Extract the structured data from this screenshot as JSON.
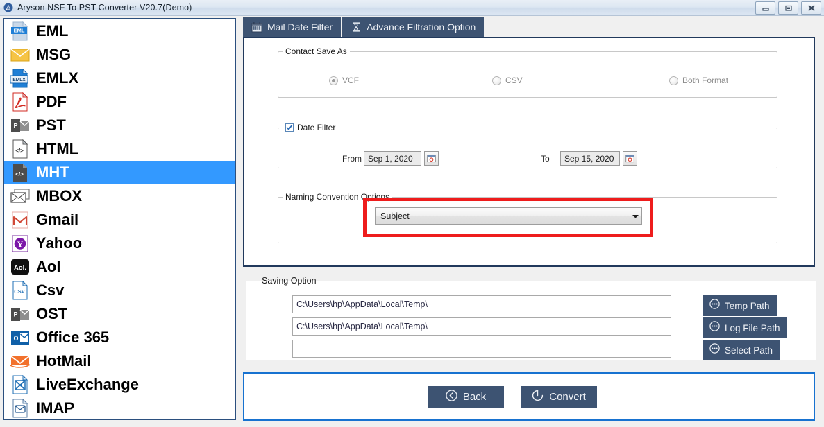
{
  "window": {
    "title": "Aryson NSF To PST Converter V20.7(Demo)",
    "app_icon": "aryson-logo-icon",
    "minimize_label": "Minimize",
    "maximize_label": "Maximize",
    "close_label": "Close",
    "accent_navy": "#3d5372",
    "accent_blue": "#1772d0",
    "highlight_blue": "#3399ff",
    "highlight_red": "#ee1c1c"
  },
  "sidebar": {
    "items": [
      {
        "label": "EML",
        "icon": "eml-file-icon",
        "selected": false
      },
      {
        "label": "MSG",
        "icon": "msg-envelope-icon",
        "selected": false
      },
      {
        "label": "EMLX",
        "icon": "emlx-file-icon",
        "selected": false
      },
      {
        "label": "PDF",
        "icon": "pdf-file-icon",
        "selected": false
      },
      {
        "label": "PST",
        "icon": "pst-outlook-icon",
        "selected": false
      },
      {
        "label": "HTML",
        "icon": "html-file-icon",
        "selected": false
      },
      {
        "label": "MHT",
        "icon": "mht-file-icon",
        "selected": true
      },
      {
        "label": "MBOX",
        "icon": "mbox-envelopes-icon",
        "selected": false
      },
      {
        "label": "Gmail",
        "icon": "gmail-icon",
        "selected": false
      },
      {
        "label": "Yahoo",
        "icon": "yahoo-icon",
        "selected": false
      },
      {
        "label": "Aol",
        "icon": "aol-icon",
        "selected": false
      },
      {
        "label": "Csv",
        "icon": "csv-file-icon",
        "selected": false
      },
      {
        "label": "OST",
        "icon": "ost-outlook-icon",
        "selected": false
      },
      {
        "label": "Office 365",
        "icon": "office365-icon",
        "selected": false
      },
      {
        "label": "HotMail",
        "icon": "hotmail-icon",
        "selected": false
      },
      {
        "label": "LiveExchange",
        "icon": "live-exchange-icon",
        "selected": false
      },
      {
        "label": "IMAP",
        "icon": "imap-envelope-icon",
        "selected": false
      }
    ]
  },
  "tabs": [
    {
      "label": "Mail Date Filter",
      "icon": "calendar-icon",
      "active": true
    },
    {
      "label": "Advance Filtration Option",
      "icon": "filter-icon",
      "active": false
    }
  ],
  "contact_save_as": {
    "legend": "Contact Save As",
    "options": [
      {
        "label": "VCF",
        "selected": true,
        "disabled": true
      },
      {
        "label": "CSV",
        "selected": false,
        "disabled": true
      },
      {
        "label": "Both Format",
        "selected": false,
        "disabled": true
      }
    ]
  },
  "date_filter": {
    "legend": "Date Filter",
    "checked": true,
    "from_label": "From",
    "from_value": "Sep 1, 2020",
    "to_label": "To",
    "to_value": "Sep 15, 2020",
    "picker_icon": "calendar-picker-icon"
  },
  "naming_convention": {
    "legend": "Naming Convention Options",
    "selected": "Subject",
    "dropdown_icon": "chevron-down-icon",
    "highlighted": true
  },
  "saving_option": {
    "legend": "Saving Option",
    "paths": [
      "C:\\Users\\hp\\AppData\\Local\\Temp\\",
      "C:\\Users\\hp\\AppData\\Local\\Temp\\",
      ""
    ],
    "buttons": [
      {
        "label": "Temp Path",
        "icon": "ellipsis-icon"
      },
      {
        "label": "Log File Path",
        "icon": "ellipsis-icon"
      },
      {
        "label": "Select Path",
        "icon": "ellipsis-icon"
      }
    ]
  },
  "footer": {
    "back": {
      "label": "Back",
      "icon": "back-arrow-icon"
    },
    "convert": {
      "label": "Convert",
      "icon": "refresh-icon"
    }
  }
}
